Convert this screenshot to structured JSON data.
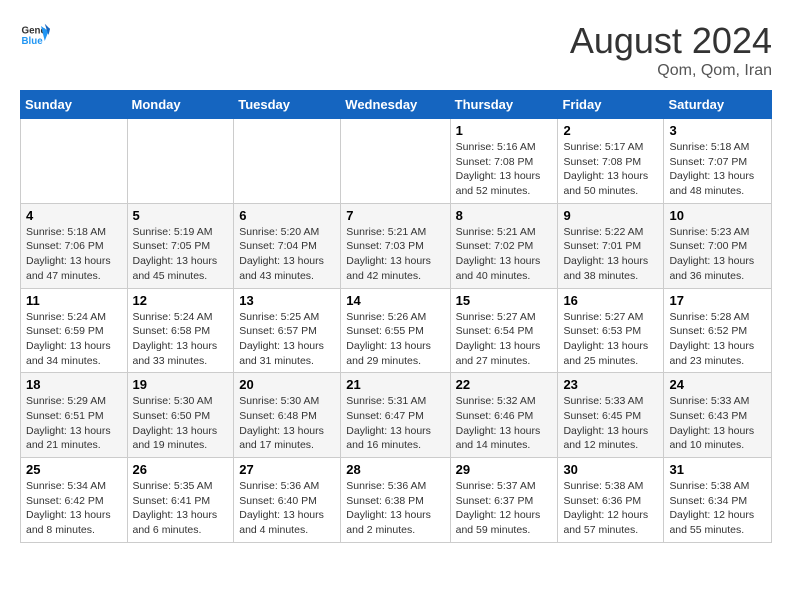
{
  "header": {
    "logo_line1": "General",
    "logo_line2": "Blue",
    "month_title": "August 2024",
    "location": "Qom, Qom, Iran"
  },
  "days_of_week": [
    "Sunday",
    "Monday",
    "Tuesday",
    "Wednesday",
    "Thursday",
    "Friday",
    "Saturday"
  ],
  "weeks": [
    [
      {
        "day": "",
        "info": ""
      },
      {
        "day": "",
        "info": ""
      },
      {
        "day": "",
        "info": ""
      },
      {
        "day": "",
        "info": ""
      },
      {
        "day": "1",
        "info": "Sunrise: 5:16 AM\nSunset: 7:08 PM\nDaylight: 13 hours\nand 52 minutes."
      },
      {
        "day": "2",
        "info": "Sunrise: 5:17 AM\nSunset: 7:08 PM\nDaylight: 13 hours\nand 50 minutes."
      },
      {
        "day": "3",
        "info": "Sunrise: 5:18 AM\nSunset: 7:07 PM\nDaylight: 13 hours\nand 48 minutes."
      }
    ],
    [
      {
        "day": "4",
        "info": "Sunrise: 5:18 AM\nSunset: 7:06 PM\nDaylight: 13 hours\nand 47 minutes."
      },
      {
        "day": "5",
        "info": "Sunrise: 5:19 AM\nSunset: 7:05 PM\nDaylight: 13 hours\nand 45 minutes."
      },
      {
        "day": "6",
        "info": "Sunrise: 5:20 AM\nSunset: 7:04 PM\nDaylight: 13 hours\nand 43 minutes."
      },
      {
        "day": "7",
        "info": "Sunrise: 5:21 AM\nSunset: 7:03 PM\nDaylight: 13 hours\nand 42 minutes."
      },
      {
        "day": "8",
        "info": "Sunrise: 5:21 AM\nSunset: 7:02 PM\nDaylight: 13 hours\nand 40 minutes."
      },
      {
        "day": "9",
        "info": "Sunrise: 5:22 AM\nSunset: 7:01 PM\nDaylight: 13 hours\nand 38 minutes."
      },
      {
        "day": "10",
        "info": "Sunrise: 5:23 AM\nSunset: 7:00 PM\nDaylight: 13 hours\nand 36 minutes."
      }
    ],
    [
      {
        "day": "11",
        "info": "Sunrise: 5:24 AM\nSunset: 6:59 PM\nDaylight: 13 hours\nand 34 minutes."
      },
      {
        "day": "12",
        "info": "Sunrise: 5:24 AM\nSunset: 6:58 PM\nDaylight: 13 hours\nand 33 minutes."
      },
      {
        "day": "13",
        "info": "Sunrise: 5:25 AM\nSunset: 6:57 PM\nDaylight: 13 hours\nand 31 minutes."
      },
      {
        "day": "14",
        "info": "Sunrise: 5:26 AM\nSunset: 6:55 PM\nDaylight: 13 hours\nand 29 minutes."
      },
      {
        "day": "15",
        "info": "Sunrise: 5:27 AM\nSunset: 6:54 PM\nDaylight: 13 hours\nand 27 minutes."
      },
      {
        "day": "16",
        "info": "Sunrise: 5:27 AM\nSunset: 6:53 PM\nDaylight: 13 hours\nand 25 minutes."
      },
      {
        "day": "17",
        "info": "Sunrise: 5:28 AM\nSunset: 6:52 PM\nDaylight: 13 hours\nand 23 minutes."
      }
    ],
    [
      {
        "day": "18",
        "info": "Sunrise: 5:29 AM\nSunset: 6:51 PM\nDaylight: 13 hours\nand 21 minutes."
      },
      {
        "day": "19",
        "info": "Sunrise: 5:30 AM\nSunset: 6:50 PM\nDaylight: 13 hours\nand 19 minutes."
      },
      {
        "day": "20",
        "info": "Sunrise: 5:30 AM\nSunset: 6:48 PM\nDaylight: 13 hours\nand 17 minutes."
      },
      {
        "day": "21",
        "info": "Sunrise: 5:31 AM\nSunset: 6:47 PM\nDaylight: 13 hours\nand 16 minutes."
      },
      {
        "day": "22",
        "info": "Sunrise: 5:32 AM\nSunset: 6:46 PM\nDaylight: 13 hours\nand 14 minutes."
      },
      {
        "day": "23",
        "info": "Sunrise: 5:33 AM\nSunset: 6:45 PM\nDaylight: 13 hours\nand 12 minutes."
      },
      {
        "day": "24",
        "info": "Sunrise: 5:33 AM\nSunset: 6:43 PM\nDaylight: 13 hours\nand 10 minutes."
      }
    ],
    [
      {
        "day": "25",
        "info": "Sunrise: 5:34 AM\nSunset: 6:42 PM\nDaylight: 13 hours\nand 8 minutes."
      },
      {
        "day": "26",
        "info": "Sunrise: 5:35 AM\nSunset: 6:41 PM\nDaylight: 13 hours\nand 6 minutes."
      },
      {
        "day": "27",
        "info": "Sunrise: 5:36 AM\nSunset: 6:40 PM\nDaylight: 13 hours\nand 4 minutes."
      },
      {
        "day": "28",
        "info": "Sunrise: 5:36 AM\nSunset: 6:38 PM\nDaylight: 13 hours\nand 2 minutes."
      },
      {
        "day": "29",
        "info": "Sunrise: 5:37 AM\nSunset: 6:37 PM\nDaylight: 12 hours\nand 59 minutes."
      },
      {
        "day": "30",
        "info": "Sunrise: 5:38 AM\nSunset: 6:36 PM\nDaylight: 12 hours\nand 57 minutes."
      },
      {
        "day": "31",
        "info": "Sunrise: 5:38 AM\nSunset: 6:34 PM\nDaylight: 12 hours\nand 55 minutes."
      }
    ]
  ]
}
